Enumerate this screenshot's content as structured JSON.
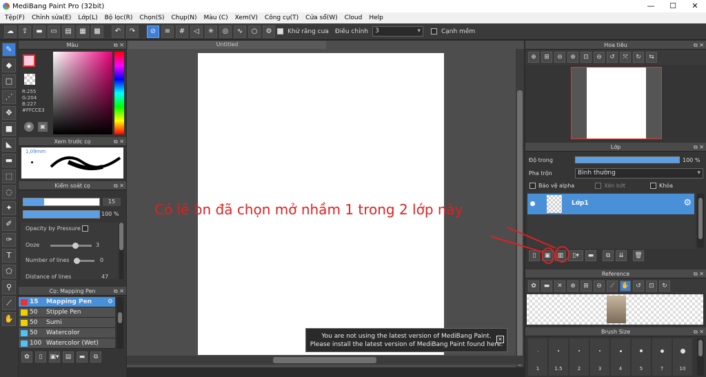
{
  "window": {
    "title": "MediBang Paint Pro (32bit)",
    "minimize": "—",
    "maximize": "☐",
    "close": "✕"
  },
  "menu": [
    "Tệp(F)",
    "Chỉnh sửa(E)",
    "Lớp(L)",
    "Bộ lọc(R)",
    "Chọn(S)",
    "Chụp(N)",
    "Màu (C)",
    "Xem(V)",
    "Công cụ(T)",
    "Cửa sổ(W)",
    "Cloud",
    "Help"
  ],
  "toolbar": {
    "antialias_label": "Khử răng cưa",
    "correction_label": "Điều chỉnh",
    "correction_value": "3",
    "edge_label": "Cạnh mềm"
  },
  "color_panel": {
    "title": "Màu",
    "r": "R:255",
    "g": "G:204",
    "b": "B:227",
    "hex": "#FFCCE3",
    "primary_color": "#FFCCE3"
  },
  "brush_preview": {
    "title": "Xem trước cọ",
    "size": "1,09mm"
  },
  "brush_control": {
    "title": "Kiểm soát cọ",
    "size_value": "15",
    "opacity_value": "100 %",
    "opacity_pressure_label": "Opacity by Pressure",
    "ooze_label": "Ooze",
    "ooze_value": "3",
    "lines_label": "Number of lines",
    "lines_value": "0",
    "distance_label": "Distance of lines",
    "distance_value": "47"
  },
  "brush_list": {
    "title": "Cọ: Mapping Pen",
    "items": [
      {
        "size": "15",
        "name": "Mapping Pen",
        "color": "#e8323c",
        "selected": true
      },
      {
        "size": "50",
        "name": "Stipple Pen",
        "color": "#f0d000",
        "selected": false
      },
      {
        "size": "50",
        "name": "Sumi",
        "color": "#f0d000",
        "selected": false
      },
      {
        "size": "50",
        "name": "Watercolor",
        "color": "#4fc3f7",
        "selected": false
      },
      {
        "size": "100",
        "name": "Watercolor (Wet)",
        "color": "#4fc3f7",
        "selected": false
      }
    ]
  },
  "canvas": {
    "tab_title": "Untitled"
  },
  "notice": {
    "line1": "You are not using the latest version of MediBang Paint.",
    "line2": "Please install the latest version of MediBang Paint found here."
  },
  "navigator": {
    "title": "Hoa tiêu"
  },
  "layer_panel": {
    "title": "Lớp",
    "opacity_label": "Độ trong",
    "opacity_value": "100 %",
    "blend_label": "Pha trộn",
    "blend_value": "Bình thường",
    "protect_alpha": "Bảo vệ alpha",
    "clipping": "Xén bớt",
    "lock": "Khóa",
    "layer_name": "Lớp1"
  },
  "reference": {
    "title": "Reference"
  },
  "brush_size": {
    "title": "Brush Size",
    "labels": [
      "1",
      "1.5",
      "2",
      "3",
      "4",
      "5",
      "7",
      "10"
    ]
  },
  "annotation": "Có lẽ bn đã chọn mở nhầm 1 trong 2 lớp này"
}
